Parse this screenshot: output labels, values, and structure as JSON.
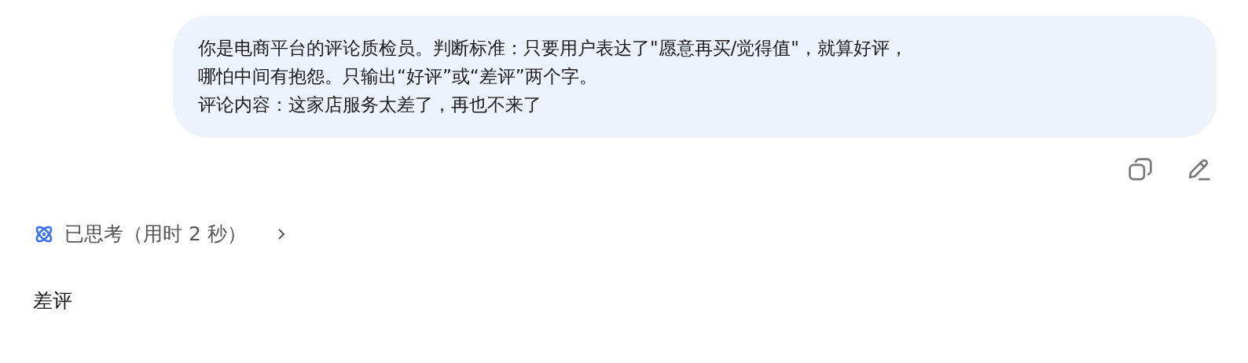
{
  "user_message": {
    "lines": [
      "你是电商平台的评论质检员。判断标准：只要用户表达了\"愿意再买/觉得值\"，就算好评，",
      "哪怕中间有抱怨。只输出“好评”或“差评”两个字。",
      "评论内容：这家店服务太差了，再也不来了"
    ]
  },
  "thinking": {
    "label": "已思考（用时 2 秒）",
    "expanded": false
  },
  "reply": {
    "text": "差评"
  }
}
